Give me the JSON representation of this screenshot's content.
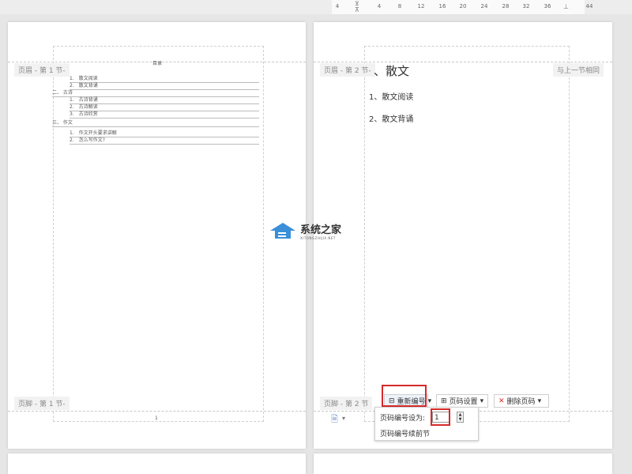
{
  "ruler": {
    "ticks": [
      "4",
      "2",
      "4",
      "8",
      "12",
      "16",
      "20",
      "24",
      "28",
      "32",
      "36",
      "44"
    ]
  },
  "page1": {
    "header_tag": "页眉 - 第 1 节-",
    "footer_tag": "页脚 - 第 1 节-",
    "toc": {
      "title": "目录",
      "lines": [
        "1.　散文阅读",
        "2.　散文背诵",
        "二、 古诗",
        "1.　古诗背诵",
        "2.　古诗解读",
        "3.　古诗欣赏",
        "三、 作文",
        "1.　作文开头要求讲解",
        "2.　怎么写作文?"
      ]
    },
    "footer_page_number": "1"
  },
  "page2": {
    "header_tag": "页眉 - 第 2 节-",
    "header_right_tag": "与上一节相同",
    "footer_tag": "页脚 - 第 2 节",
    "heading": "、散文",
    "items": [
      "1、散文阅读",
      "2、散文背诵"
    ]
  },
  "toolbar": {
    "renumber_label": "重新编号",
    "page_setup_label": "页码设置",
    "delete_label": "删除页码"
  },
  "dropdown": {
    "set_label": "页码编号设为:",
    "set_value": "1",
    "continue_label": "页码编号续前节"
  },
  "watermark": {
    "name": "系统之家",
    "url": "XITONGZHIJIA.NET"
  }
}
